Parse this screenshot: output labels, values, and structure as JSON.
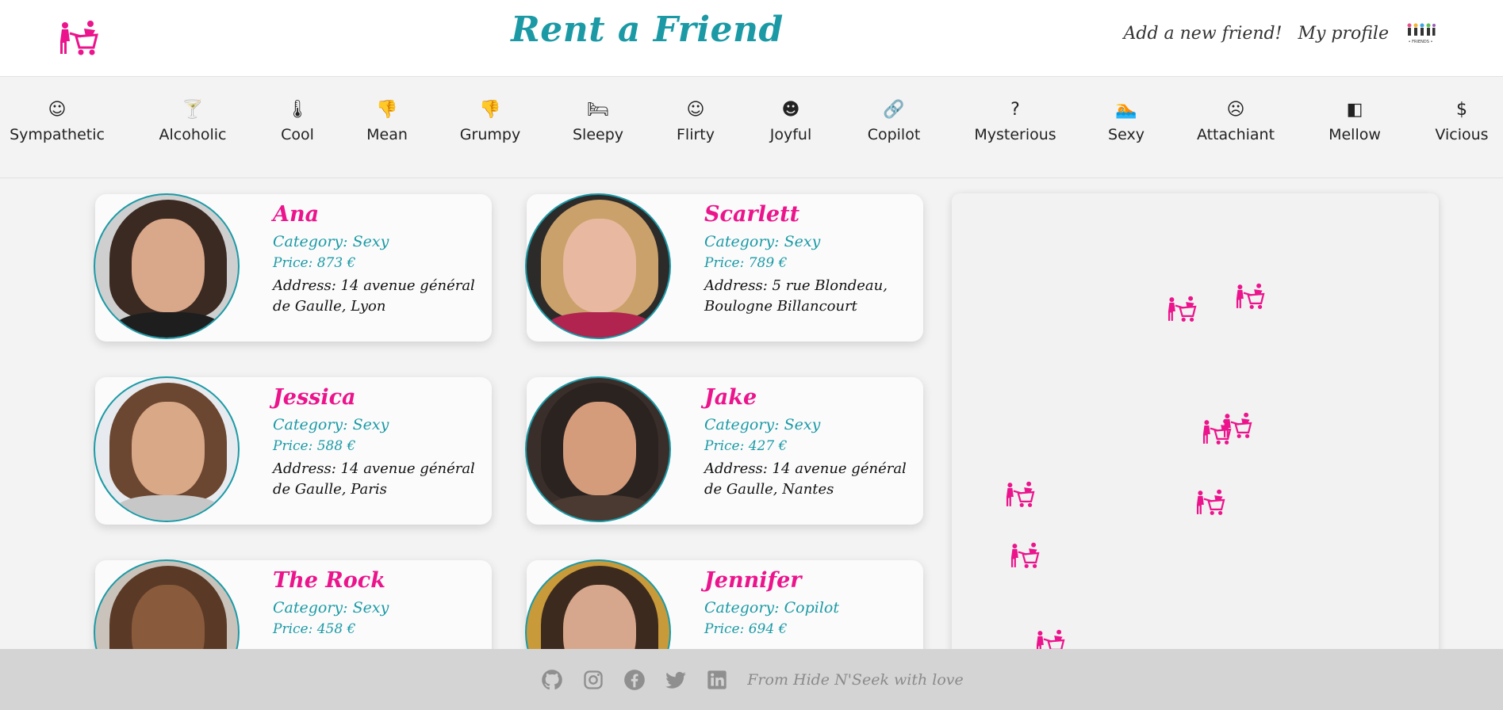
{
  "navbar": {
    "brand": "Rent a Friend",
    "add_friend": "Add a new friend!",
    "my_profile": "My profile"
  },
  "categories": [
    {
      "label": "Sympathetic",
      "icon": "smile-icon"
    },
    {
      "label": "Alcoholic",
      "icon": "cocktail-icon"
    },
    {
      "label": "Cool",
      "icon": "thermometer-icon"
    },
    {
      "label": "Mean",
      "icon": "thumbs-down-icon"
    },
    {
      "label": "Grumpy",
      "icon": "thumbs-down-icon"
    },
    {
      "label": "Sleepy",
      "icon": "bed-icon"
    },
    {
      "label": "Flirty",
      "icon": "smile-icon"
    },
    {
      "label": "Joyful",
      "icon": "grin-icon"
    },
    {
      "label": "Copilot",
      "icon": "link-icon"
    },
    {
      "label": "Mysterious",
      "icon": "question-icon"
    },
    {
      "label": "Sexy",
      "icon": "swimmer-icon"
    },
    {
      "label": "Attachiant",
      "icon": "frown-icon"
    },
    {
      "label": "Mellow",
      "icon": "toggle-icon"
    },
    {
      "label": "Vicious",
      "icon": "dollar-icon"
    }
  ],
  "friends": [
    {
      "name": "Ana",
      "category": "Category: Sexy",
      "price": "Price: 873 €",
      "address": "Address: 14 avenue général de Gaulle, Lyon"
    },
    {
      "name": "Scarlett",
      "category": "Category: Sexy",
      "price": "Price: 789 €",
      "address": "Address: 5 rue Blondeau, Boulogne Billancourt"
    },
    {
      "name": "Jessica",
      "category": "Category: Sexy",
      "price": "Price: 588 €",
      "address": "Address: 14 avenue général de Gaulle, Paris"
    },
    {
      "name": "Jake",
      "category": "Category: Sexy",
      "price": "Price: 427 €",
      "address": "Address: 14 avenue général de Gaulle, Nantes"
    },
    {
      "name": "The Rock",
      "category": "Category: Sexy",
      "price": "Price: 458 €",
      "address": ""
    },
    {
      "name": "Jennifer",
      "category": "Category: Copilot",
      "price": "Price: 694 €",
      "address": ""
    }
  ],
  "map": {
    "marker_count": 11,
    "marker_icon": "friend-cart-icon"
  },
  "footer": {
    "text": "From Hide N'Seek with love",
    "social_icons": [
      "github-icon",
      "instagram-icon",
      "facebook-icon",
      "twitter-icon",
      "linkedin-icon"
    ]
  },
  "colors": {
    "accent": "#1b9aa6",
    "brand_pink": "#ec148c",
    "background": "#f3f3f3",
    "footer": "#d4d4d4"
  }
}
